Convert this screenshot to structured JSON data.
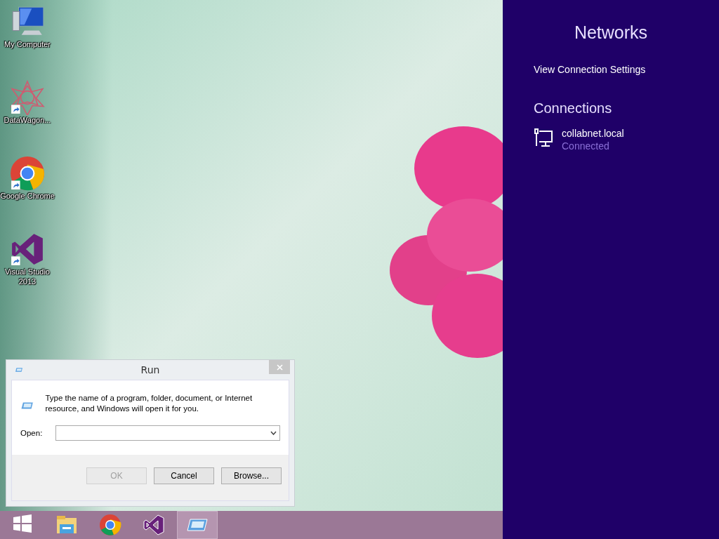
{
  "desktop": {
    "icons": [
      {
        "label": "My Computer",
        "kind": "computer",
        "shortcut": false
      },
      {
        "label": "DataWagon...",
        "kind": "star",
        "shortcut": true
      },
      {
        "label": "Google Chrome",
        "kind": "chrome",
        "shortcut": true
      },
      {
        "label": "Visual Studio 2013",
        "kind": "vs",
        "shortcut": true
      }
    ]
  },
  "run_dialog": {
    "title": "Run",
    "message": "Type the name of a program, folder, document, or Internet resource, and Windows will open it for you.",
    "open_label": "Open:",
    "buttons": [
      {
        "label": "OK",
        "disabled": true
      },
      {
        "label": "Cancel",
        "disabled": false
      },
      {
        "label": "Browse...",
        "disabled": false
      }
    ]
  },
  "taskbar": {
    "items": [
      {
        "kind": "start",
        "selected": false
      },
      {
        "kind": "explorer",
        "selected": false
      },
      {
        "kind": "chrome",
        "selected": false
      },
      {
        "kind": "vs",
        "selected": false
      },
      {
        "kind": "run",
        "selected": true
      }
    ]
  },
  "networks_panel": {
    "title": "Networks",
    "settings_link": "View Connection Settings",
    "section_title": "Connections",
    "connections": [
      {
        "name": "collabnet.local",
        "status": "Connected"
      }
    ]
  }
}
